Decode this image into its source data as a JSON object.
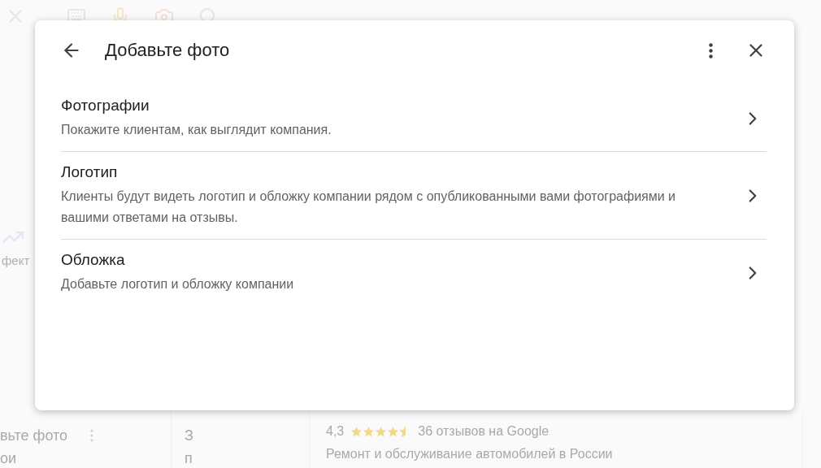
{
  "background": {
    "side_label": "фект",
    "left_card": {
      "title": "вьте фото",
      "line": "ои"
    },
    "middle_card": {
      "title": "З",
      "line": "п"
    },
    "right_card": {
      "rating": "4,3",
      "stars": 4.5,
      "reviews": "36 отзывов на Google",
      "category": "Ремонт и обслуживание автомобилей в России"
    }
  },
  "dialog": {
    "title": "Добавьте фото",
    "items": [
      {
        "title": "Фотографии",
        "description": "Покажите клиентам, как выглядит компания."
      },
      {
        "title": "Логотип",
        "description": "Клиенты будут видеть логотип и обложку компании рядом с опубликованными вами фотографиями и вашими ответами на отзывы."
      },
      {
        "title": "Обложка",
        "description": "Добавьте логотип и обложку компании"
      }
    ]
  }
}
